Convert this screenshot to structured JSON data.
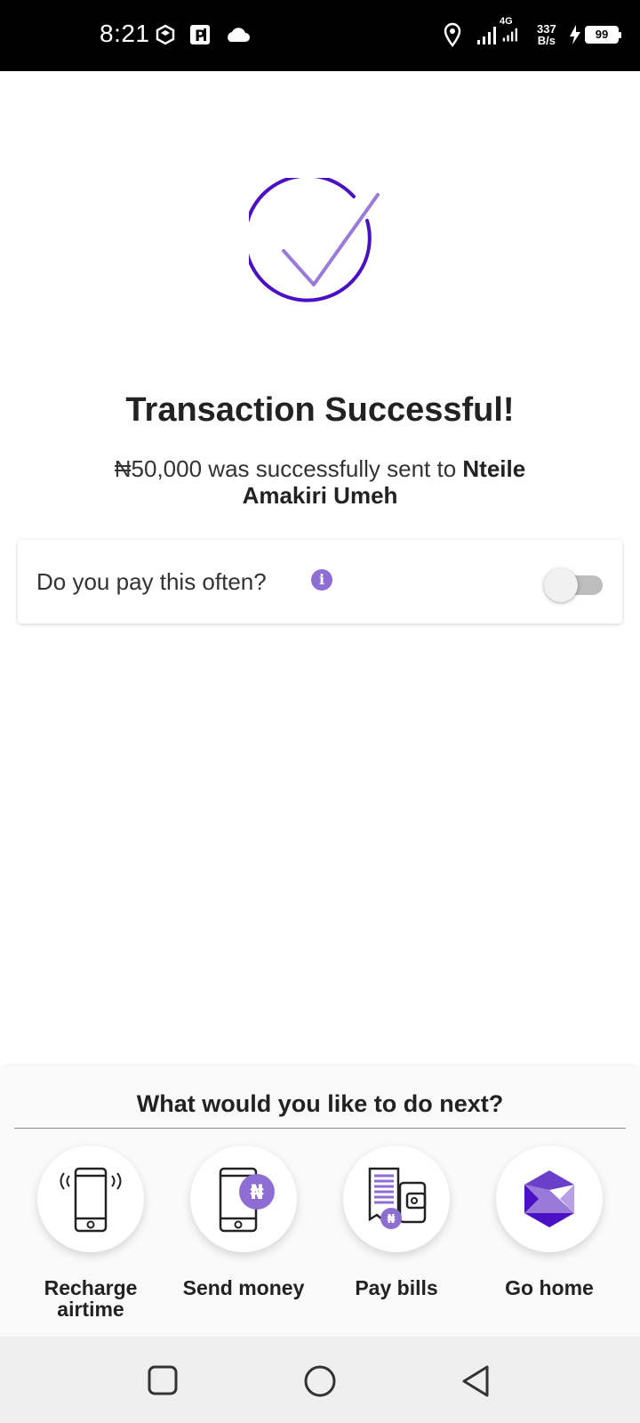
{
  "status_bar": {
    "time": "8:21",
    "network_type": "4G",
    "speed_value": "337",
    "speed_unit": "B/s",
    "battery": "99",
    "icons": [
      "app-icon",
      "parking-icon",
      "cloud-icon",
      "location-icon",
      "signal-icon",
      "signal-4g-icon",
      "charging-icon",
      "battery-icon"
    ]
  },
  "success": {
    "title": "Transaction Successful!",
    "message_prefix": "₦50,000 was successfully sent to ",
    "recipient": "Nteile Amakiri Umeh"
  },
  "recurring": {
    "label": "Do you pay this often?",
    "toggle_on": false
  },
  "next_actions": {
    "title": "What would you like to do next?",
    "items": [
      {
        "label": "Recharge airtime",
        "icon": "phone-ringing-icon"
      },
      {
        "label": "Send money",
        "icon": "send-money-icon"
      },
      {
        "label": "Pay bills",
        "icon": "bill-wallet-icon"
      },
      {
        "label": "Go home",
        "icon": "home-logo-icon"
      }
    ]
  },
  "colors": {
    "accent": "#4a10c4",
    "accent_light": "#9a7ad8",
    "info": "#8e6ed3",
    "status_bar_bg": "#000000",
    "nav_bar_bg": "#efefef"
  },
  "nav": [
    "recent-apps-icon",
    "home-icon",
    "back-icon"
  ]
}
